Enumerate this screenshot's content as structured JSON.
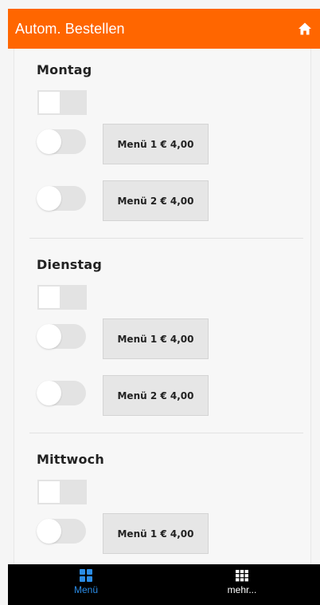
{
  "header": {
    "title": "Autom. Bestellen",
    "home_icon": "home-icon"
  },
  "days": [
    {
      "name": "Montag",
      "menus": [
        {
          "label": "Menü 1 € 4,00"
        },
        {
          "label": "Menü 2 € 4,00"
        }
      ]
    },
    {
      "name": "Dienstag",
      "menus": [
        {
          "label": "Menü 1 € 4,00"
        },
        {
          "label": "Menü 2 € 4,00"
        }
      ]
    },
    {
      "name": "Mittwoch",
      "menus": [
        {
          "label": "Menü 1 € 4,00"
        }
      ]
    }
  ],
  "tabbar": {
    "tabs": [
      {
        "label": "Menü",
        "icon": "grid-icon",
        "active": true
      },
      {
        "label": "mehr...",
        "icon": "apps-icon",
        "active": false
      }
    ]
  },
  "colors": {
    "accent": "#ff6600",
    "active_tab": "#2b8ce6",
    "tabbar_bg": "#000000"
  }
}
